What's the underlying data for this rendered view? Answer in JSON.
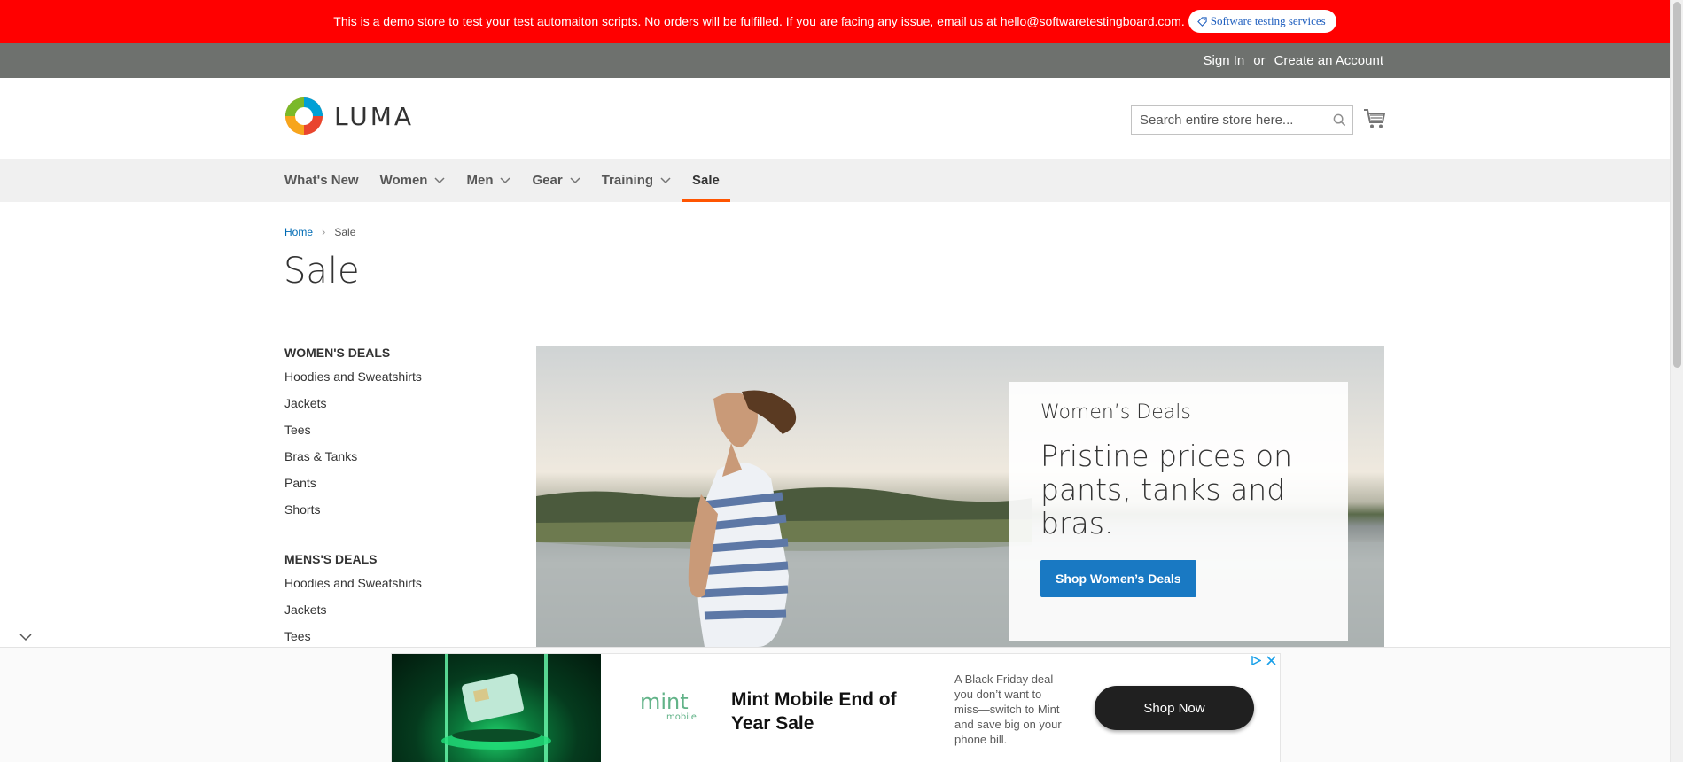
{
  "demo_banner": {
    "text": "This is a demo store to test your test automaiton scripts. No orders will be fulfilled. If you are facing any issue, email us at hello@softwaretestingboard.com.",
    "pill_label": "Software testing services"
  },
  "top_links": {
    "sign_in": "Sign In",
    "or": "or",
    "create_account": "Create an Account"
  },
  "header": {
    "logo_text": "LUMA",
    "search_placeholder": "Search entire store here..."
  },
  "nav": {
    "items": [
      {
        "label": "What's New",
        "has_dropdown": false
      },
      {
        "label": "Women",
        "has_dropdown": true
      },
      {
        "label": "Men",
        "has_dropdown": true
      },
      {
        "label": "Gear",
        "has_dropdown": true
      },
      {
        "label": "Training",
        "has_dropdown": true
      },
      {
        "label": "Sale",
        "has_dropdown": false,
        "active": true
      }
    ]
  },
  "breadcrumbs": {
    "home": "Home",
    "separator": "›",
    "current": "Sale"
  },
  "page_title": "Sale",
  "sidebar": {
    "womens": {
      "heading": "WOMEN'S DEALS",
      "items": [
        "Hoodies and Sweatshirts",
        "Jackets",
        "Tees",
        "Bras & Tanks",
        "Pants",
        "Shorts"
      ]
    },
    "mens": {
      "heading": "MENS'S DEALS",
      "items": [
        "Hoodies and Sweatshirts",
        "Jackets",
        "Tees"
      ]
    }
  },
  "hero": {
    "kicker": "Women’s Deals",
    "headline": "Pristine prices on pants, tanks and bras.",
    "button": "Shop Women’s Deals"
  },
  "ad": {
    "brand": "mint",
    "brand_sub": "mobile",
    "title": "Mint Mobile End of Year Sale",
    "description": "A Black Friday deal you don’t want to miss—switch to Mint and save big on your phone bill.",
    "button": "Shop Now"
  },
  "colors": {
    "banner_red": "#ff0000",
    "panel_gray": "#6e716e",
    "link_blue": "#006bb4",
    "primary_button": "#1979c3",
    "active_underline": "#ff5501",
    "nav_bg": "#f0f0f0"
  }
}
